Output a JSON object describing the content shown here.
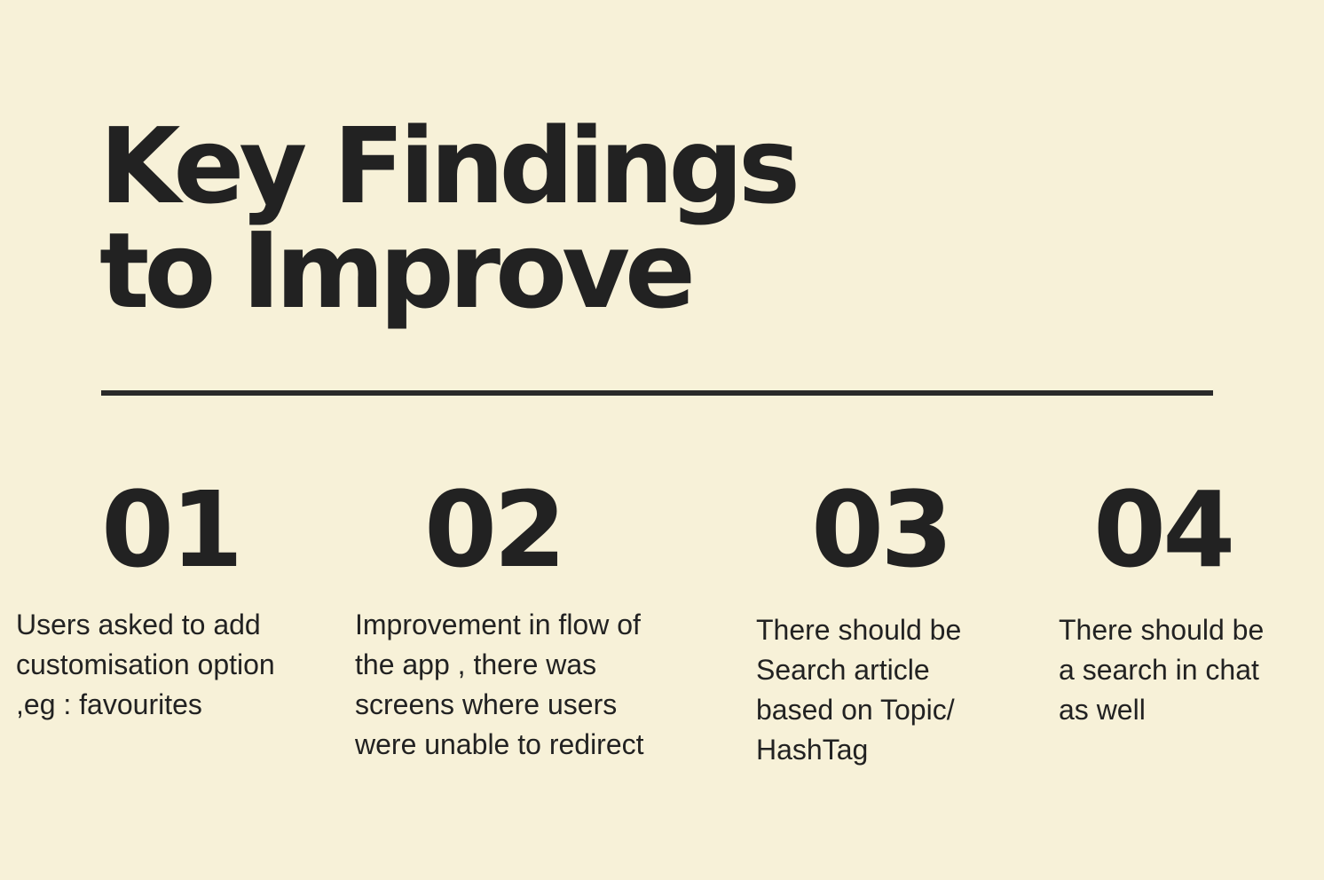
{
  "title": {
    "line1": "Key Findings",
    "line2": "to Improve"
  },
  "findings": [
    {
      "number": "01",
      "text": "Users asked to add\ncustomisation option\n,eg : favourites"
    },
    {
      "number": "02",
      "text": "Improvement in flow of\nthe app , there was\nscreens where users\nwere unable to redirect"
    },
    {
      "number": "03",
      "text": "There should be\nSearch article\nbased on Topic/\nHashTag"
    },
    {
      "number": "04",
      "text": "There should be\na search in chat\nas well"
    }
  ],
  "colors": {
    "background": "#f7f1d8",
    "text": "#222222",
    "divider": "#2a2a2a"
  }
}
